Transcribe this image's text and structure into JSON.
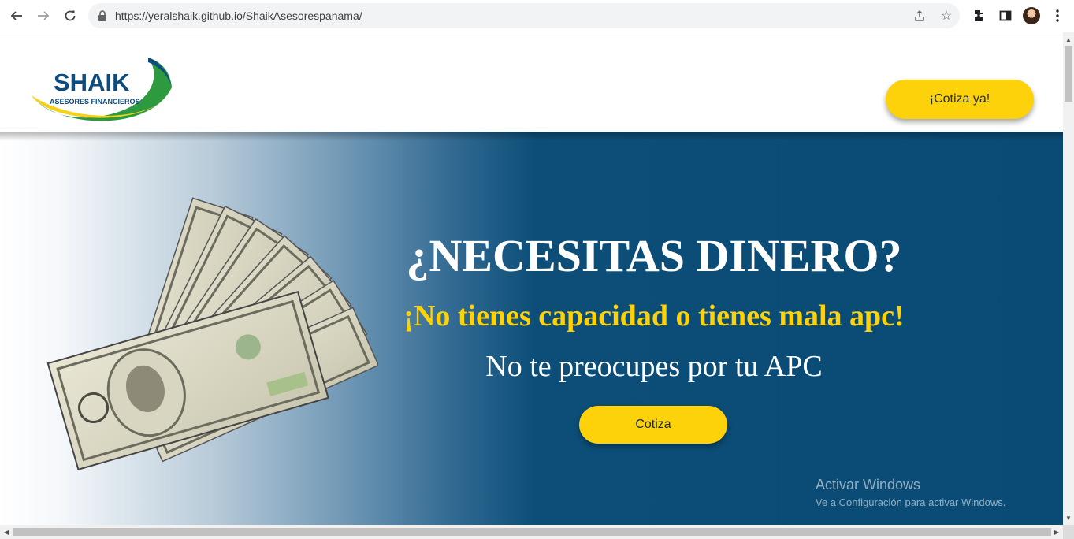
{
  "browser": {
    "url": "https://yeralshaik.github.io/ShaikAsesorespanama/"
  },
  "header": {
    "logo_brand": "SHAIK",
    "logo_tagline": "ASESORES FINANCIEROS",
    "cta_label": "¡Cotiza ya!"
  },
  "hero": {
    "title": "¿NECESITAS DINERO?",
    "subtitle": "¡No tienes capacidad o tienes mala apc!",
    "line": "No te preocupes por tu APC",
    "cta_label": "Cotiza"
  },
  "watermark": {
    "title": "Activar Windows",
    "subtitle": "Ve a Configuración para activar Windows."
  },
  "colors": {
    "brand_blue": "#0f4c7e",
    "accent_yellow": "#fdd20b",
    "hero_blue": "#0a4b76",
    "logo_green": "#2e9a3f"
  }
}
